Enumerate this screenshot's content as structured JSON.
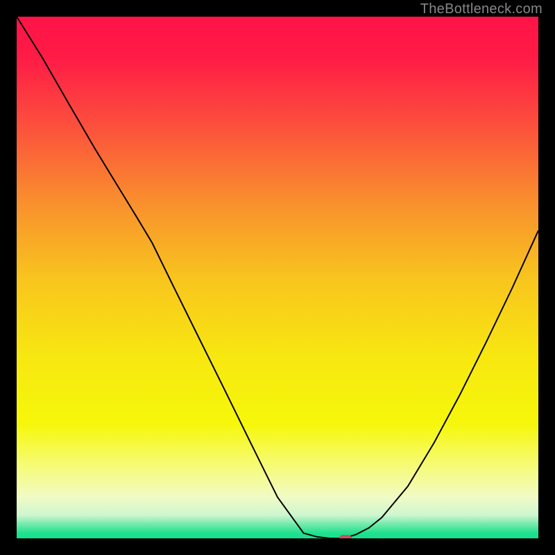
{
  "watermark": "TheBottleneck.com",
  "chart_data": {
    "type": "line",
    "title": "",
    "xlabel": "",
    "ylabel": "",
    "xlim": [
      0,
      100
    ],
    "ylim": [
      0,
      100
    ],
    "background_gradient": {
      "type": "vertical",
      "stops": [
        {
          "pos": 0.0,
          "color": "#ff1348"
        },
        {
          "pos": 0.08,
          "color": "#ff1c46"
        },
        {
          "pos": 0.2,
          "color": "#fc4c3d"
        },
        {
          "pos": 0.35,
          "color": "#f98d2e"
        },
        {
          "pos": 0.5,
          "color": "#f8c41e"
        },
        {
          "pos": 0.65,
          "color": "#f7e711"
        },
        {
          "pos": 0.78,
          "color": "#f6f70a"
        },
        {
          "pos": 0.86,
          "color": "#f6fb76"
        },
        {
          "pos": 0.92,
          "color": "#f1fbc4"
        },
        {
          "pos": 0.955,
          "color": "#cff6d0"
        },
        {
          "pos": 0.975,
          "color": "#68e9a7"
        },
        {
          "pos": 0.99,
          "color": "#1ee18f"
        },
        {
          "pos": 1.0,
          "color": "#17df8c"
        }
      ]
    },
    "series": [
      {
        "name": "bottleneck-curve",
        "color": "#000000",
        "width": 2,
        "x": [
          0.0,
          5.0,
          10.0,
          15.0,
          20.0,
          23.0,
          26.0,
          30.0,
          35.0,
          40.0,
          45.0,
          50.0,
          55.0,
          57.5,
          60.0,
          62.5,
          65.0,
          67.5,
          70.0,
          75.0,
          80.0,
          85.0,
          90.0,
          95.0,
          100.0
        ],
        "y": [
          100.0,
          92.0,
          83.3,
          74.7,
          66.5,
          61.6,
          56.6,
          48.4,
          38.3,
          28.2,
          18.0,
          7.9,
          1.0,
          0.3,
          0.0,
          0.0,
          0.7,
          2.0,
          4.0,
          10.0,
          18.3,
          27.6,
          37.6,
          48.0,
          59.0
        ]
      }
    ],
    "marker": {
      "name": "optimal-point",
      "x": 63.0,
      "y": 0.0,
      "color": "#c1565c"
    }
  }
}
